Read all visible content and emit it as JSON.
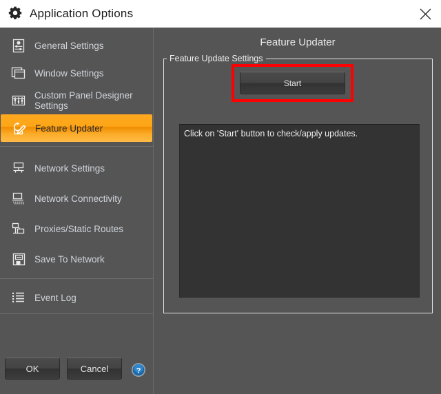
{
  "window": {
    "title": "Application Options",
    "gear_icon": "gear-icon",
    "close_icon": "close-icon"
  },
  "colors": {
    "accent": "#ffa81f",
    "highlight": "#ff0000",
    "sidebar_bg": "#555555",
    "panel_bg": "#555555",
    "titlebar_bg": "#ffffff",
    "log_bg": "#333333",
    "text": "#cfd4da"
  },
  "sidebar": {
    "groups": [
      {
        "items": [
          {
            "label": "General Settings",
            "icon": "sliders-settings-icon",
            "selected": false
          },
          {
            "label": "Window Settings",
            "icon": "windows-stack-icon",
            "selected": false
          },
          {
            "label": "Custom Panel Designer Settings",
            "icon": "faders-panel-icon",
            "selected": false
          },
          {
            "label": "Feature Updater",
            "icon": "update-pencil-icon",
            "selected": true
          }
        ]
      },
      {
        "items": [
          {
            "label": "Network Settings",
            "icon": "network-node-icon",
            "selected": false
          },
          {
            "label": "Network Connectivity",
            "icon": "network-connectivity-icon",
            "selected": false
          },
          {
            "label": "Proxies/Static Routes",
            "icon": "proxy-routes-icon",
            "selected": false
          },
          {
            "label": "Save To Network",
            "icon": "save-floppy-icon",
            "selected": false
          }
        ]
      },
      {
        "items": [
          {
            "label": "Event Log",
            "icon": "list-log-icon",
            "selected": false
          }
        ]
      }
    ]
  },
  "footer": {
    "ok_label": "OK",
    "cancel_label": "Cancel",
    "help_icon": "help-question-icon"
  },
  "main": {
    "title": "Feature Updater",
    "groupbox_label": "Feature Update Settings",
    "start_label": "Start",
    "log_text": "Click on 'Start' button to check/apply updates."
  }
}
